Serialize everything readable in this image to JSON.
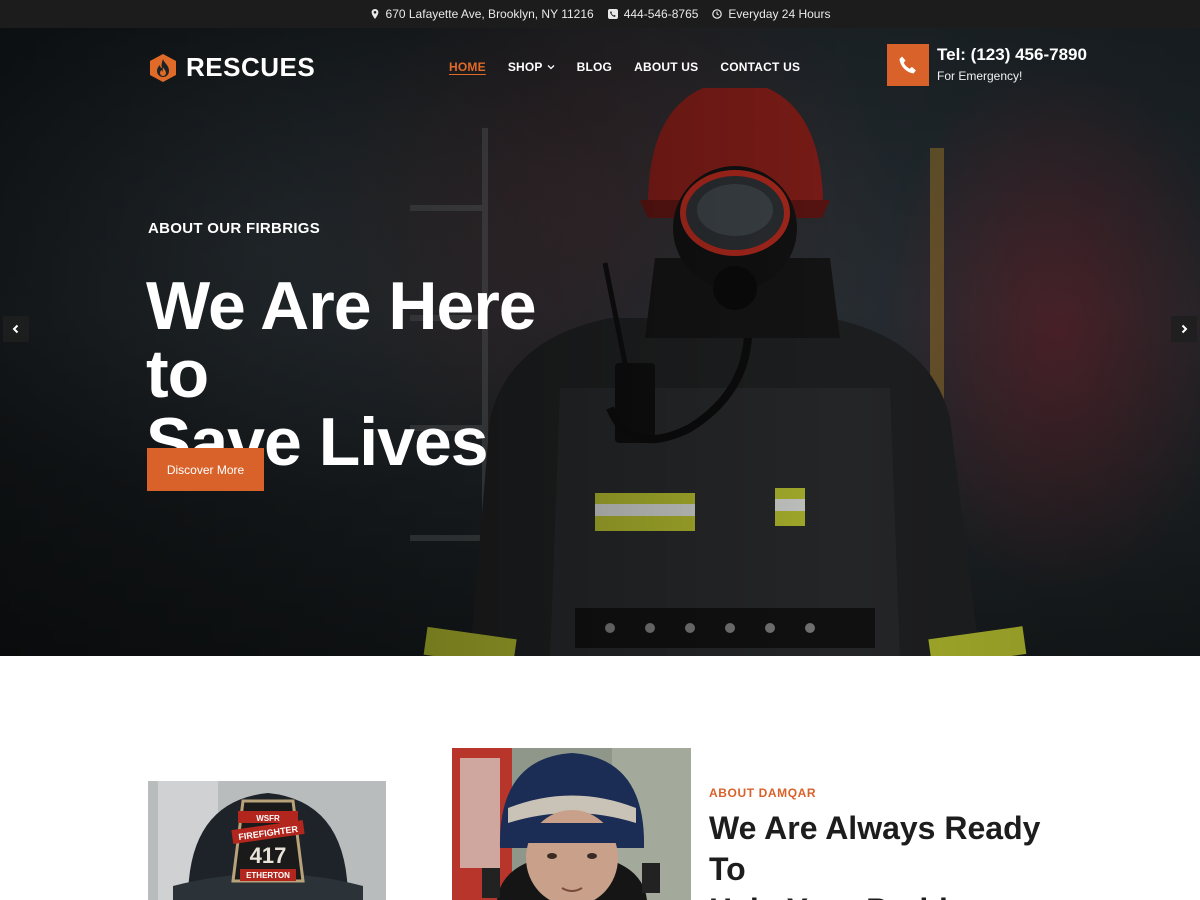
{
  "topbar": {
    "address": "670 Lafayette Ave, Brooklyn, NY 11216",
    "phone": "444-546-8765",
    "hours": "Everyday 24 Hours"
  },
  "brand": {
    "name": "RESCUES",
    "accent_color": "#d9622a"
  },
  "nav": {
    "items": [
      {
        "label": "HOME",
        "active": true
      },
      {
        "label": "SHOP",
        "has_dropdown": true
      },
      {
        "label": "BLOG"
      },
      {
        "label": "ABOUT US"
      },
      {
        "label": "CONTACT US"
      }
    ]
  },
  "emergency": {
    "tel": "Tel: (123) 456-7890",
    "label": "For Emergency!"
  },
  "hero": {
    "eyebrow": "ABOUT OUR FIRBRIGS",
    "title_line1": "We Are Here to",
    "title_line2": "Save Lives",
    "button": "Discover More"
  },
  "about": {
    "eyebrow": "ABOUT DAMQAR",
    "title_line1": "We Are Always Ready To",
    "title_line2": "Help Your Problems"
  },
  "helmet_badge": {
    "top": "WSFR",
    "name": "FIREFIGHTER",
    "number": "417",
    "bottom": "ETHERTON"
  }
}
